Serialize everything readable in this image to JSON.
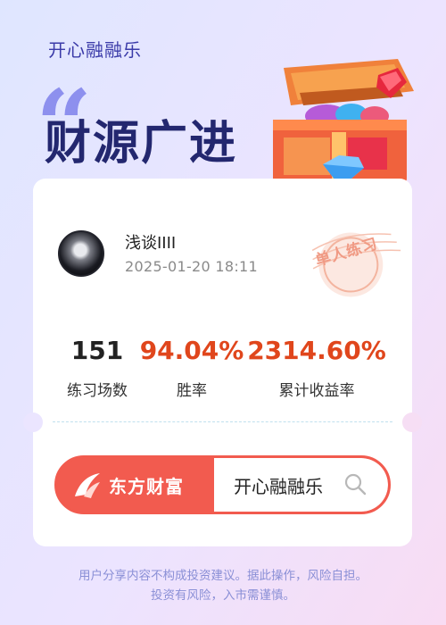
{
  "brand": {
    "name": "开心融融乐"
  },
  "headline": "财源广进",
  "quote_mark": "“",
  "profile": {
    "username": "浅谈IIII",
    "timestamp": "2025-01-20 18:11",
    "stamp": "单人练习"
  },
  "stats": [
    {
      "value": "151",
      "label": "练习场数",
      "color": "#222222"
    },
    {
      "value": "94.04%",
      "label": "胜率",
      "color": "#e0461c"
    },
    {
      "value": "2314.60%",
      "label": "累计收益率",
      "color": "#e0461c"
    }
  ],
  "search": {
    "brand": "东方财富",
    "query": "开心融融乐",
    "icon": "search-icon"
  },
  "disclaimer": {
    "line1": "用户分享内容不构成投资建议。据此操作，风险自担。",
    "line2": "投资有风险，入市需谨慎。"
  },
  "colors": {
    "accent": "#e0461c",
    "search_bar": "#f25b4f",
    "headline": "#23276f"
  }
}
